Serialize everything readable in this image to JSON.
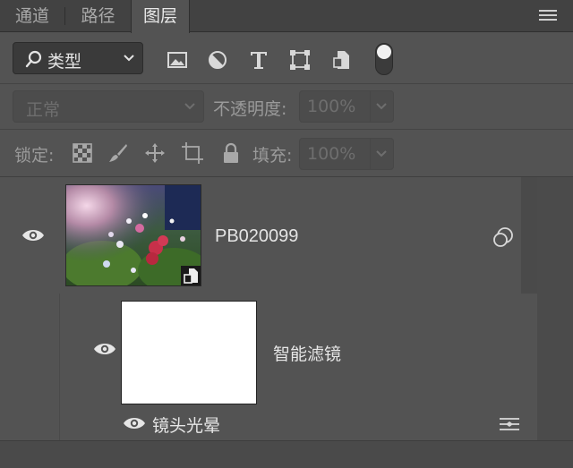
{
  "tabs": [
    {
      "label": "通道",
      "active": false
    },
    {
      "label": "路径",
      "active": false
    },
    {
      "label": "图层",
      "active": true
    }
  ],
  "filter": {
    "kind_label": "类型",
    "icons": [
      "image-filter-icon",
      "adjustment-filter-icon",
      "type-filter-icon",
      "shape-filter-icon",
      "smart-object-filter-icon"
    ]
  },
  "blend": {
    "mode": "正常",
    "opacity_label": "不透明度:",
    "opacity_value": "100%"
  },
  "lock": {
    "label": "锁定:",
    "fill_label": "填充:",
    "fill_value": "100%"
  },
  "layers": {
    "layer_name": "PB020099",
    "smart_filters_label": "智能滤镜",
    "filter_name": "镜头光晕"
  },
  "colors": {
    "panel_bg": "#535353",
    "tab_bar_bg": "#424242",
    "text": "#e4e4e4"
  }
}
